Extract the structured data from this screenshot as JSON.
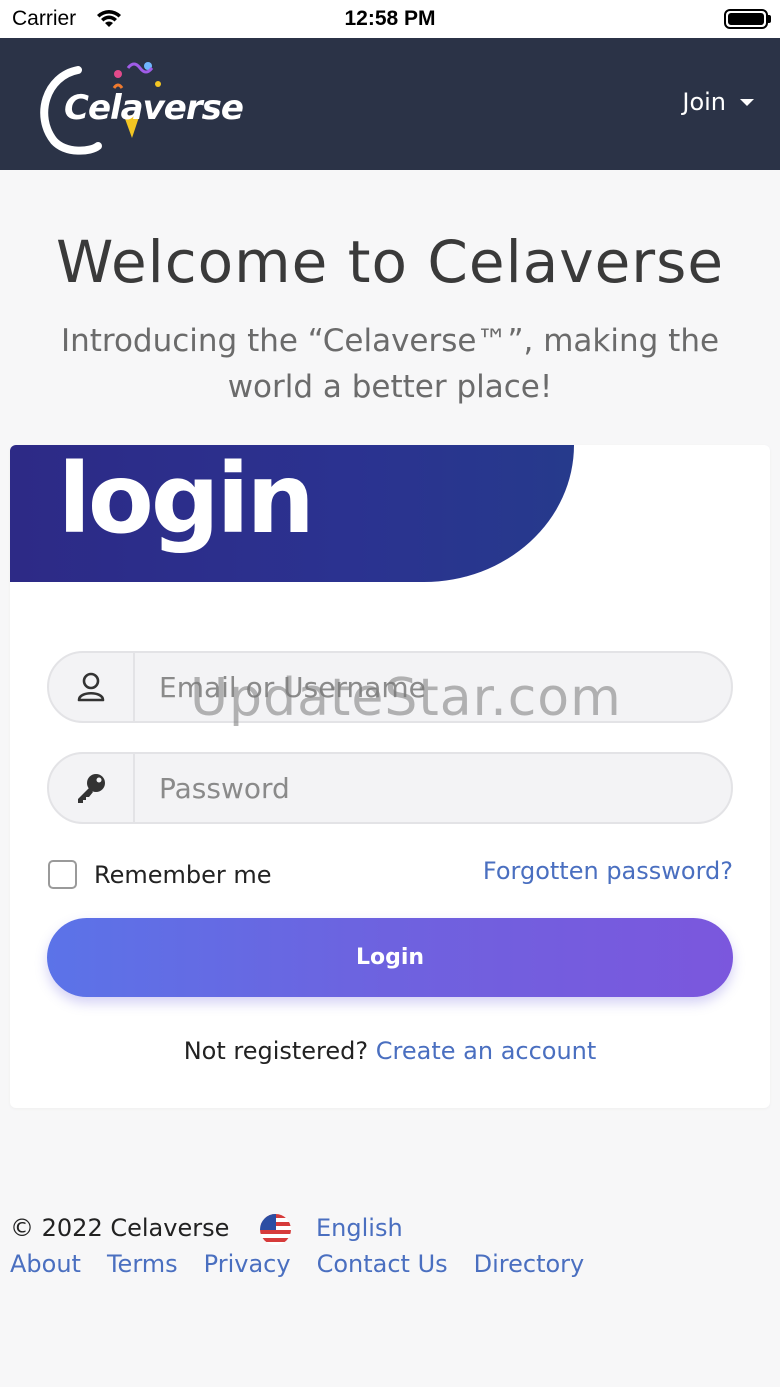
{
  "status_bar": {
    "carrier": "Carrier",
    "time": "12:58 PM"
  },
  "navbar": {
    "logo_text": "Celaverse",
    "join_label": "Join"
  },
  "hero": {
    "title": "Welcome to Celaverse",
    "subtitle": "Introducing the “Celaverse™”, making the world a better place!"
  },
  "login_card": {
    "banner_text": "login",
    "email_placeholder": "Email or Username",
    "password_placeholder": "Password",
    "remember_label": "Remember me",
    "forgot_label": "Forgotten password?",
    "login_button": "Login",
    "not_registered": "Not registered? ",
    "create_account": "Create an account"
  },
  "footer": {
    "copyright": "© 2022 Celaverse",
    "language": "English",
    "links": [
      "About",
      "Terms",
      "Privacy",
      "Contact Us",
      "Directory"
    ]
  },
  "watermark": "UpdateStar.com",
  "colors": {
    "navbar": "#2b3347",
    "link": "#4a6fc0",
    "button_start": "#5b73e8",
    "button_end": "#7b57dd",
    "banner": "#2d2a86"
  }
}
